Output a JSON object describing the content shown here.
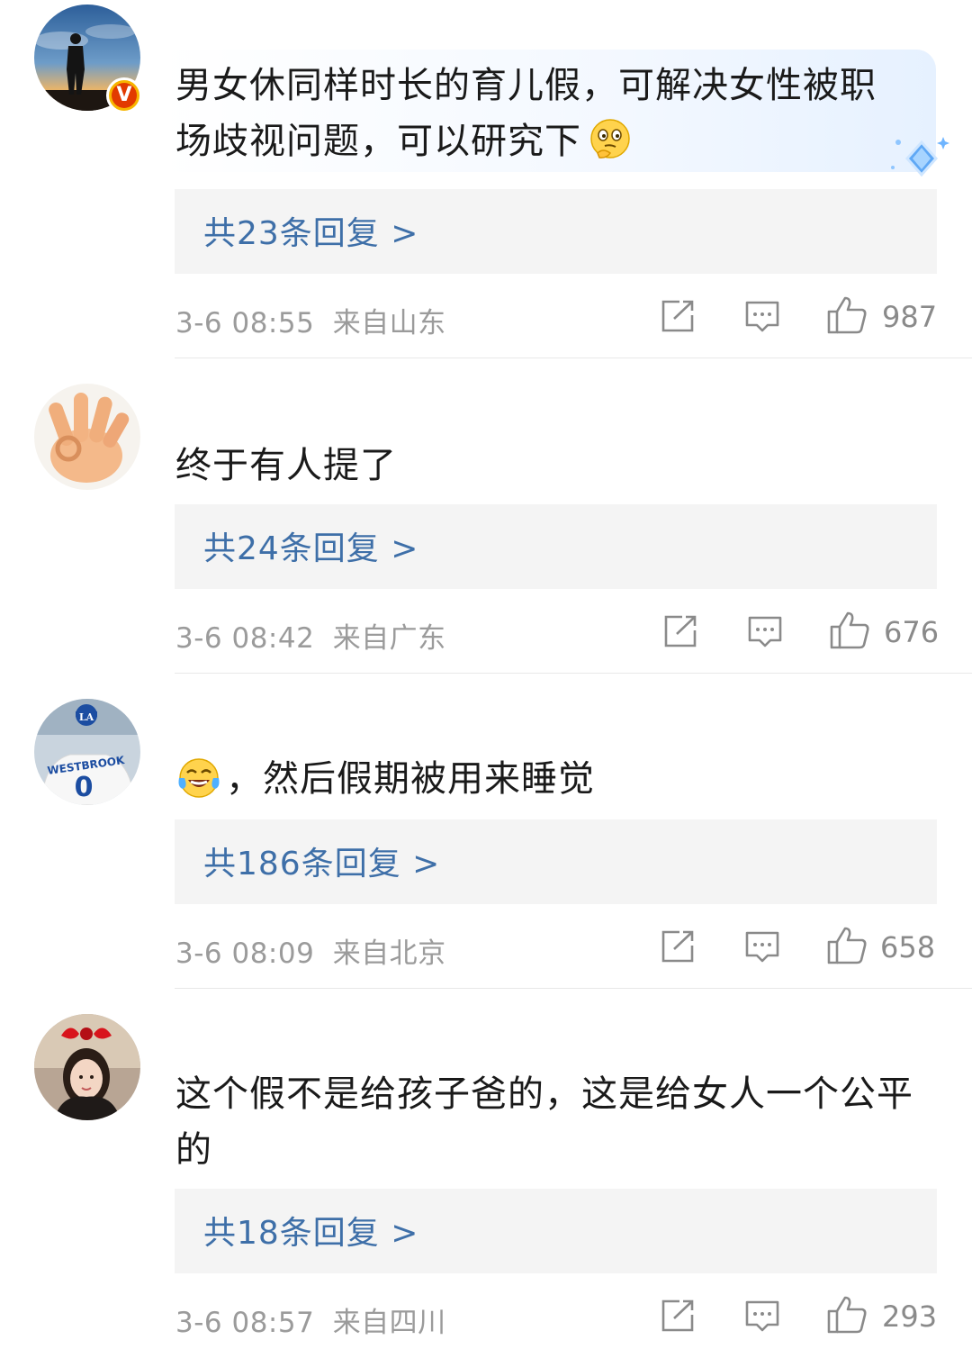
{
  "comments": [
    {
      "text_line1": "男女休同样时长的育儿假，可解决女性被职",
      "text_line2": "场歧视问题，可以研究下",
      "emoji": "thinking-face-icon",
      "verified": true,
      "replies": "共23条回复 >",
      "time": "3-6 08:55",
      "location": "来自山东",
      "likes": "987"
    },
    {
      "text_line1": "终于有人提了",
      "replies": "共24条回复 >",
      "time": "3-6 08:42",
      "location": "来自广东",
      "likes": "676"
    },
    {
      "text_line1": "，然后假期被用来睡觉",
      "emoji": "tears-of-joy-icon",
      "replies": "共186条回复 >",
      "time": "3-6 08:09",
      "location": "来自北京",
      "likes": "658",
      "avatar_jersey_name": "WESTBROOK",
      "avatar_jersey_number": "0"
    },
    {
      "text_line1": "这个假不是给孩子爸的，这是给女人一个公平",
      "text_line2": "的",
      "replies": "共18条回复 >",
      "time": "3-6 08:57",
      "location": "来自四川",
      "likes": "293"
    }
  ],
  "colors": {
    "reply_link": "#3e6fa8",
    "meta_gray": "#9b9b9b",
    "reply_box": "#f4f4f4",
    "verified_badge": "#f7b500"
  }
}
